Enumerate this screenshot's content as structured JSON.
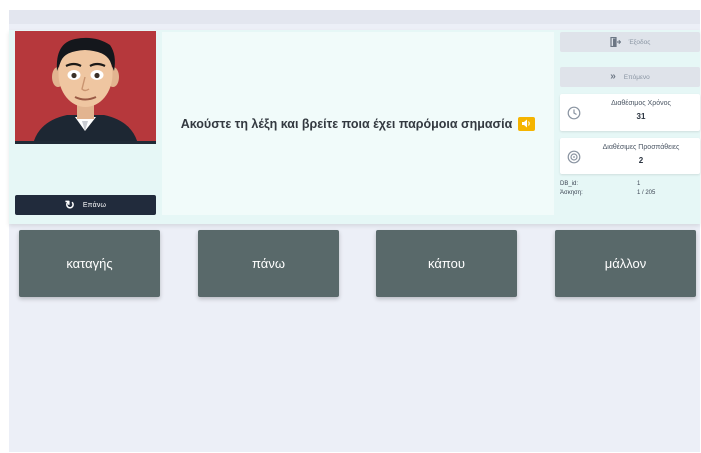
{
  "prompt": {
    "text": "Ακούστε τη λέξη και βρείτε ποια έχει παρόμοια σημασία"
  },
  "left_panel": {
    "repeat_label": "Επάνω"
  },
  "sidebar": {
    "exit_label": "Έξοδος",
    "next_label": "Επόμενο",
    "time": {
      "label": "Διαθέσιμος Χρόνος",
      "value": "31"
    },
    "attempts": {
      "label": "Διαθέσιμες Προσπάθειες",
      "value": "2"
    },
    "meta": [
      {
        "key": "DB_id:",
        "value": "1"
      },
      {
        "key": "Άσκηση:",
        "value": "1 / 205"
      }
    ]
  },
  "answers": [
    "καταγής",
    "πάνω",
    "κάπου",
    "μάλλον"
  ],
  "colors": {
    "answer_bg": "#59696a",
    "panel_bg": "#e6f7f6",
    "speaker_accent": "#f5b400",
    "repeat_button": "#212b3c"
  }
}
